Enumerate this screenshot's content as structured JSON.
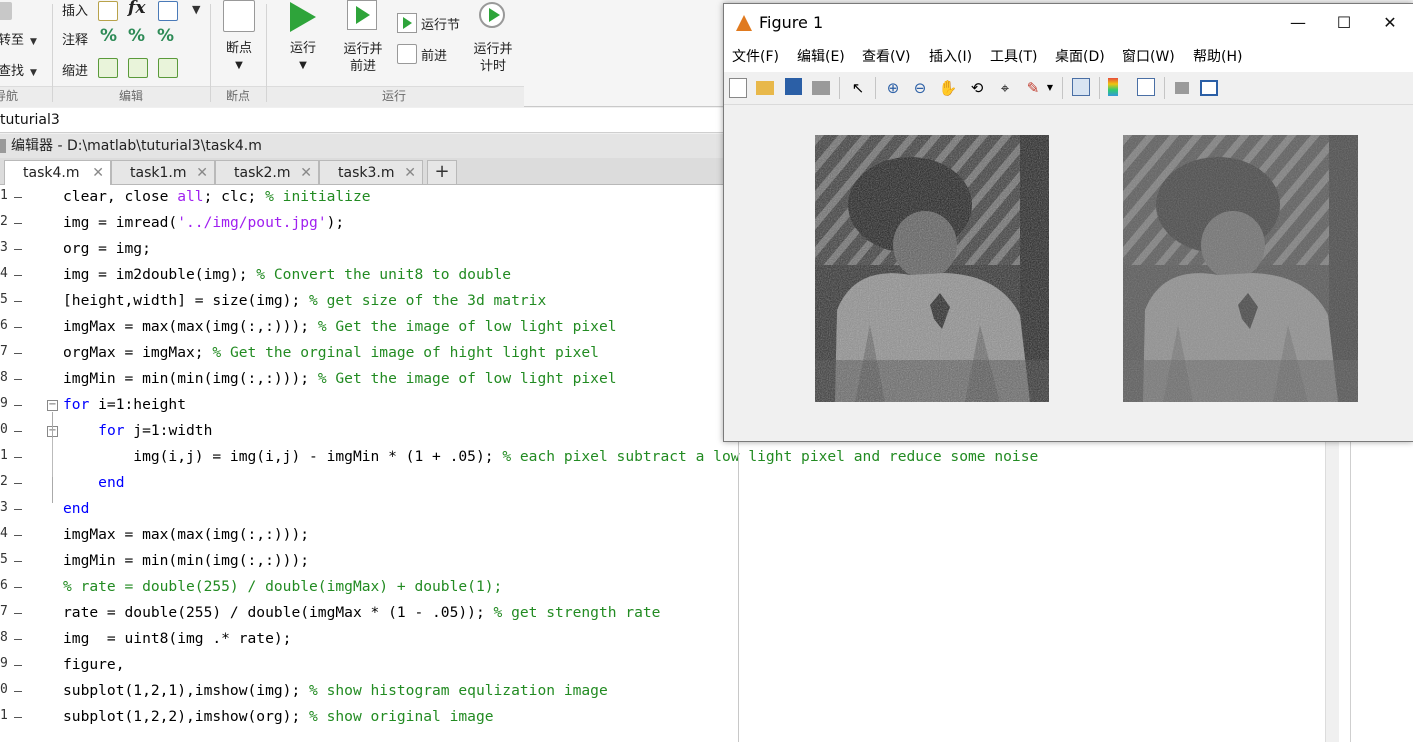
{
  "toolstrip": {
    "navigate": {
      "goto": "转至",
      "find": "查找",
      "section": "导航"
    },
    "edit": {
      "insert": "插入",
      "fx": "fx",
      "comment": "注释",
      "indent": "缩进",
      "section": "编辑"
    },
    "breakpoints": {
      "label": "断点",
      "section": "断点"
    },
    "run": {
      "run": "运行",
      "run_advance_1": "运行并",
      "run_advance_2": "前进",
      "run_section": "运行节",
      "advance": "前进",
      "run_time_1": "运行并",
      "run_time_2": "计时",
      "section": "运行"
    }
  },
  "address": {
    "path": "tuturial3"
  },
  "editor": {
    "title": "编辑器 - D:\\matlab\\tuturial3\\task4.m",
    "tabs": [
      {
        "label": "task4.m",
        "active": true
      },
      {
        "label": "task1.m",
        "active": false
      },
      {
        "label": "task2.m",
        "active": false
      },
      {
        "label": "task3.m",
        "active": false
      }
    ],
    "add_tab": "+",
    "line_numbers": [
      "1",
      "2",
      "3",
      "4",
      "5",
      "6",
      "7",
      "8",
      "9",
      "0",
      "1",
      "2",
      "3",
      "4",
      "5",
      "6",
      "7",
      "8",
      "9",
      "0",
      "1"
    ],
    "lines": [
      [
        {
          "t": "clear, close ",
          "c": ""
        },
        {
          "t": "all",
          "c": "str"
        },
        {
          "t": "; clc; ",
          "c": ""
        },
        {
          "t": "% initialize",
          "c": "cm"
        }
      ],
      [
        {
          "t": "img = imread(",
          "c": ""
        },
        {
          "t": "'../img/pout.jpg'",
          "c": "str"
        },
        {
          "t": ");",
          "c": ""
        }
      ],
      [
        {
          "t": "org = img;",
          "c": ""
        }
      ],
      [
        {
          "t": "img = im2double(img); ",
          "c": ""
        },
        {
          "t": "% Convert the unit8 to double",
          "c": "cm"
        }
      ],
      [
        {
          "t": "[height,width] = size(img); ",
          "c": ""
        },
        {
          "t": "% get size of the 3d matrix",
          "c": "cm"
        }
      ],
      [
        {
          "t": "imgMax = max(max(img(:,:))); ",
          "c": ""
        },
        {
          "t": "% Get the image of low light pixel",
          "c": "cm"
        }
      ],
      [
        {
          "t": "orgMax = imgMax; ",
          "c": ""
        },
        {
          "t": "% Get the orginal image of hight light pixel",
          "c": "cm"
        }
      ],
      [
        {
          "t": "imgMin = min(min(img(:,:))); ",
          "c": ""
        },
        {
          "t": "% Get the image of low light pixel",
          "c": "cm"
        }
      ],
      [
        {
          "t": "for",
          "c": "kw"
        },
        {
          "t": " i=1:height",
          "c": ""
        }
      ],
      [
        {
          "t": "    ",
          "c": ""
        },
        {
          "t": "for",
          "c": "kw"
        },
        {
          "t": " j=1:width",
          "c": ""
        }
      ],
      [
        {
          "t": "        img(i,j) = img(i,j) - imgMin * (1 + .05); ",
          "c": ""
        },
        {
          "t": "% each pixel subtract a low light pixel and reduce some noise",
          "c": "cm"
        }
      ],
      [
        {
          "t": "    ",
          "c": ""
        },
        {
          "t": "end",
          "c": "kw"
        }
      ],
      [
        {
          "t": "end",
          "c": "kw"
        }
      ],
      [
        {
          "t": "imgMax = max(max(img(:,:)));",
          "c": ""
        }
      ],
      [
        {
          "t": "imgMin = min(min(img(:,:)));",
          "c": ""
        }
      ],
      [
        {
          "t": "% rate = double(255) / double(imgMax) + double(1);",
          "c": "cm"
        }
      ],
      [
        {
          "t": "rate = double(255) / double(imgMax * (1 - .05)); ",
          "c": ""
        },
        {
          "t": "% get strength rate",
          "c": "cm"
        }
      ],
      [
        {
          "t": "img  = uint8(img .* rate);",
          "c": ""
        }
      ],
      [
        {
          "t": "figure,",
          "c": ""
        }
      ],
      [
        {
          "t": "subplot(1,2,1),imshow(img); ",
          "c": ""
        },
        {
          "t": "% show histogram equlization image",
          "c": "cm"
        }
      ],
      [
        {
          "t": "subplot(1,2,2),imshow(org); ",
          "c": ""
        },
        {
          "t": "% show original image",
          "c": "cm"
        }
      ]
    ]
  },
  "figure": {
    "title": "Figure 1",
    "menus": [
      "文件(F)",
      "编辑(E)",
      "查看(V)",
      "插入(I)",
      "工具(T)",
      "桌面(D)",
      "窗口(W)",
      "帮助(H)"
    ],
    "minimize": "—",
    "maximize": "☐",
    "close": "✕"
  },
  "colors": {
    "keyword": "#0000ff",
    "string": "#a020f0",
    "comment": "#228b22"
  }
}
